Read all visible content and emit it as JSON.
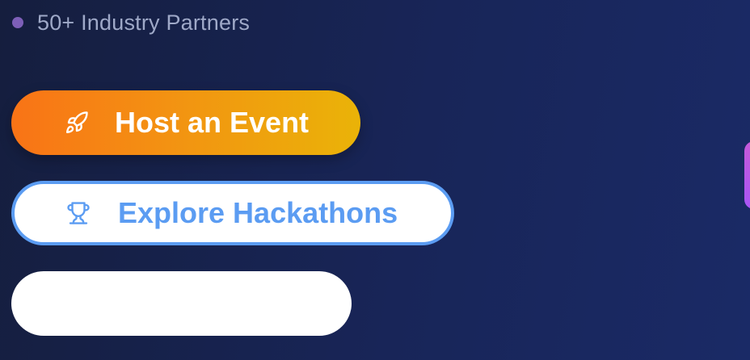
{
  "stat": {
    "text": "50+ Industry Partners",
    "dot_color": "#7d5fb8"
  },
  "buttons": {
    "host": {
      "label": "Host an Event",
      "icon": "rocket-icon"
    },
    "explore": {
      "label": "Explore Hackathons",
      "icon": "trophy-icon"
    },
    "third": {
      "label": ""
    }
  },
  "colors": {
    "background": "#182558",
    "host_gradient_start": "#f97316",
    "host_gradient_end": "#eab308",
    "explore_accent": "#5b9cf2",
    "side_accent": "#c65ad8"
  }
}
